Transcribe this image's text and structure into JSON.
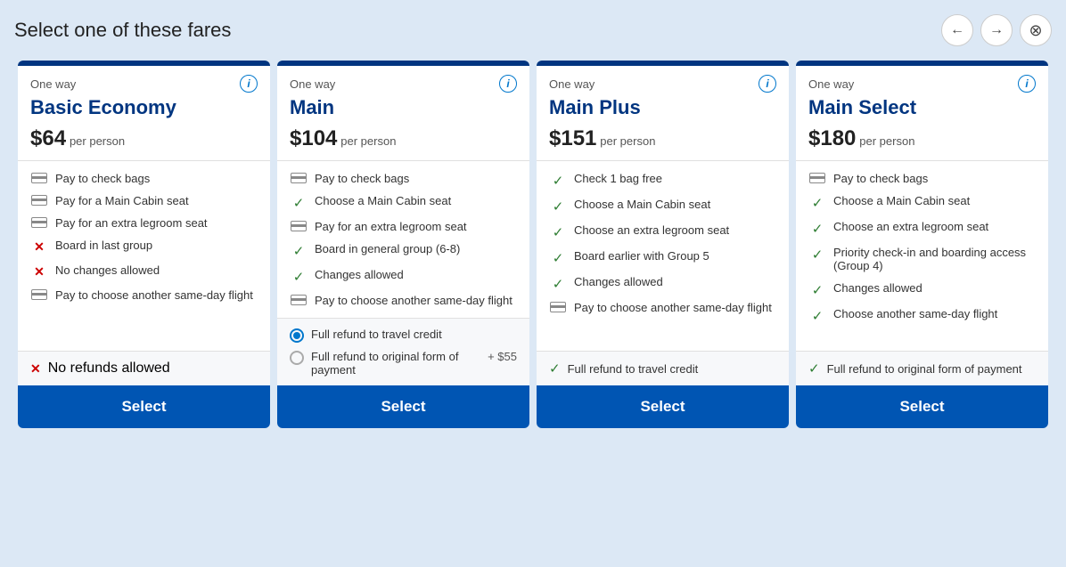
{
  "header": {
    "title": "Select one of these fares",
    "nav_prev_label": "←",
    "nav_next_label": "→",
    "close_label": "✕"
  },
  "fares": [
    {
      "id": "basic-economy",
      "one_way": "One way",
      "name": "Basic Economy",
      "price": "$64",
      "per_person": "per person",
      "features": [
        {
          "type": "credit",
          "text": "Pay to check bags"
        },
        {
          "type": "credit",
          "text": "Pay for a Main Cabin seat"
        },
        {
          "type": "credit",
          "text": "Pay for an extra legroom seat"
        },
        {
          "type": "x",
          "text": "Board in last group"
        },
        {
          "type": "x",
          "text": "No changes allowed"
        },
        {
          "type": "credit",
          "text": "Pay to choose another same-day flight"
        }
      ],
      "refund": {
        "type": "none",
        "label": "No refunds allowed"
      },
      "select_label": "Select"
    },
    {
      "id": "main",
      "one_way": "One way",
      "name": "Main",
      "price": "$104",
      "per_person": "per person",
      "features": [
        {
          "type": "credit",
          "text": "Pay to check bags"
        },
        {
          "type": "check",
          "text": "Choose a Main Cabin seat"
        },
        {
          "type": "credit",
          "text": "Pay for an extra legroom seat"
        },
        {
          "type": "check",
          "text": "Board in general group (6-8)"
        },
        {
          "type": "check",
          "text": "Changes allowed"
        },
        {
          "type": "credit",
          "text": "Pay to choose another same-day flight"
        }
      ],
      "refund": {
        "type": "options",
        "option1": "Full refund to travel credit",
        "option1_selected": true,
        "option2": "Full refund to original form of payment",
        "option2_extra": "+ $55"
      },
      "select_label": "Select"
    },
    {
      "id": "main-plus",
      "one_way": "One way",
      "name": "Main Plus",
      "price": "$151",
      "per_person": "per person",
      "features": [
        {
          "type": "check",
          "text": "Check 1 bag free"
        },
        {
          "type": "check",
          "text": "Choose a Main Cabin seat"
        },
        {
          "type": "check",
          "text": "Choose an extra legroom seat"
        },
        {
          "type": "check",
          "text": "Board earlier with Group 5"
        },
        {
          "type": "check",
          "text": "Changes allowed"
        },
        {
          "type": "credit",
          "text": "Pay to choose another same-day flight"
        }
      ],
      "refund": {
        "type": "check",
        "label": "Full refund to travel credit"
      },
      "select_label": "Select"
    },
    {
      "id": "main-select",
      "one_way": "One way",
      "name": "Main Select",
      "price": "$180",
      "per_person": "per person",
      "features": [
        {
          "type": "credit",
          "text": "Pay to check bags"
        },
        {
          "type": "check",
          "text": "Choose a Main Cabin seat"
        },
        {
          "type": "check",
          "text": "Choose an extra legroom seat"
        },
        {
          "type": "check",
          "text": "Priority check-in and boarding access (Group 4)"
        },
        {
          "type": "check",
          "text": "Changes allowed"
        },
        {
          "type": "check",
          "text": "Choose another same-day flight"
        }
      ],
      "refund": {
        "type": "check",
        "label": "Full refund to original form of payment"
      },
      "select_label": "Select"
    }
  ]
}
